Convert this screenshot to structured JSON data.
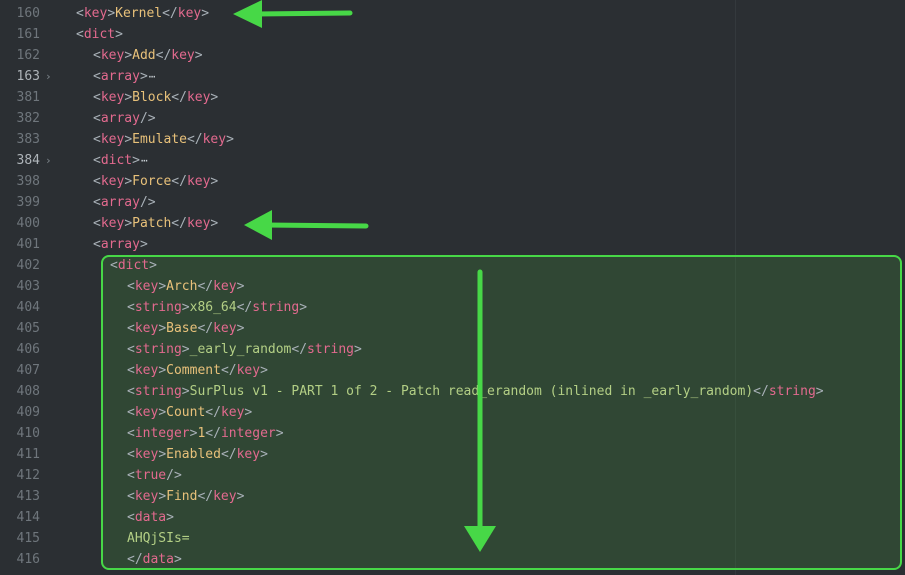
{
  "lines": [
    {
      "num": "160",
      "indent": 0,
      "fold": "",
      "parts": [
        [
          "p",
          "<"
        ],
        [
          "t",
          "key"
        ],
        [
          "p",
          ">"
        ],
        [
          "k",
          "Kernel"
        ],
        [
          "p",
          "</"
        ],
        [
          "t",
          "key"
        ],
        [
          "p",
          ">"
        ]
      ]
    },
    {
      "num": "161",
      "indent": 0,
      "fold": "",
      "parts": [
        [
          "p",
          "<"
        ],
        [
          "t",
          "dict"
        ],
        [
          "p",
          ">"
        ]
      ]
    },
    {
      "num": "162",
      "indent": 1,
      "fold": "",
      "parts": [
        [
          "p",
          "<"
        ],
        [
          "t",
          "key"
        ],
        [
          "p",
          ">"
        ],
        [
          "k",
          "Add"
        ],
        [
          "p",
          "</"
        ],
        [
          "t",
          "key"
        ],
        [
          "p",
          ">"
        ]
      ]
    },
    {
      "num": "163",
      "indent": 1,
      "fold": "›",
      "active": true,
      "collapsed": true,
      "parts": [
        [
          "p",
          "<"
        ],
        [
          "t",
          "array"
        ],
        [
          "p",
          ">"
        ]
      ]
    },
    {
      "num": "381",
      "indent": 1,
      "fold": "",
      "parts": [
        [
          "p",
          "<"
        ],
        [
          "t",
          "key"
        ],
        [
          "p",
          ">"
        ],
        [
          "k",
          "Block"
        ],
        [
          "p",
          "</"
        ],
        [
          "t",
          "key"
        ],
        [
          "p",
          ">"
        ]
      ]
    },
    {
      "num": "382",
      "indent": 1,
      "fold": "",
      "parts": [
        [
          "p",
          "<"
        ],
        [
          "t",
          "array"
        ],
        [
          "p",
          "/>"
        ]
      ]
    },
    {
      "num": "383",
      "indent": 1,
      "fold": "",
      "parts": [
        [
          "p",
          "<"
        ],
        [
          "t",
          "key"
        ],
        [
          "p",
          ">"
        ],
        [
          "k",
          "Emulate"
        ],
        [
          "p",
          "</"
        ],
        [
          "t",
          "key"
        ],
        [
          "p",
          ">"
        ]
      ]
    },
    {
      "num": "384",
      "indent": 1,
      "fold": "›",
      "active": true,
      "collapsed": true,
      "parts": [
        [
          "p",
          "<"
        ],
        [
          "t",
          "dict"
        ],
        [
          "p",
          ">"
        ]
      ]
    },
    {
      "num": "398",
      "indent": 1,
      "fold": "",
      "parts": [
        [
          "p",
          "<"
        ],
        [
          "t",
          "key"
        ],
        [
          "p",
          ">"
        ],
        [
          "k",
          "Force"
        ],
        [
          "p",
          "</"
        ],
        [
          "t",
          "key"
        ],
        [
          "p",
          ">"
        ]
      ]
    },
    {
      "num": "399",
      "indent": 1,
      "fold": "",
      "parts": [
        [
          "p",
          "<"
        ],
        [
          "t",
          "array"
        ],
        [
          "p",
          "/>"
        ]
      ]
    },
    {
      "num": "400",
      "indent": 1,
      "fold": "",
      "parts": [
        [
          "p",
          "<"
        ],
        [
          "t",
          "key"
        ],
        [
          "p",
          ">"
        ],
        [
          "k",
          "Patch"
        ],
        [
          "p",
          "</"
        ],
        [
          "t",
          "key"
        ],
        [
          "p",
          ">"
        ]
      ]
    },
    {
      "num": "401",
      "indent": 1,
      "fold": "",
      "parts": [
        [
          "p",
          "<"
        ],
        [
          "t",
          "array"
        ],
        [
          "p",
          ">"
        ]
      ]
    },
    {
      "num": "402",
      "indent": 2,
      "fold": "",
      "parts": [
        [
          "p",
          "<"
        ],
        [
          "t",
          "dict"
        ],
        [
          "p",
          ">"
        ]
      ]
    },
    {
      "num": "403",
      "indent": 3,
      "fold": "",
      "parts": [
        [
          "p",
          "<"
        ],
        [
          "t",
          "key"
        ],
        [
          "p",
          ">"
        ],
        [
          "k",
          "Arch"
        ],
        [
          "p",
          "</"
        ],
        [
          "t",
          "key"
        ],
        [
          "p",
          ">"
        ]
      ]
    },
    {
      "num": "404",
      "indent": 3,
      "fold": "",
      "parts": [
        [
          "p",
          "<"
        ],
        [
          "t",
          "string"
        ],
        [
          "p",
          ">"
        ],
        [
          "s",
          "x86_64"
        ],
        [
          "p",
          "</"
        ],
        [
          "t",
          "string"
        ],
        [
          "p",
          ">"
        ]
      ]
    },
    {
      "num": "405",
      "indent": 3,
      "fold": "",
      "parts": [
        [
          "p",
          "<"
        ],
        [
          "t",
          "key"
        ],
        [
          "p",
          ">"
        ],
        [
          "k",
          "Base"
        ],
        [
          "p",
          "</"
        ],
        [
          "t",
          "key"
        ],
        [
          "p",
          ">"
        ]
      ]
    },
    {
      "num": "406",
      "indent": 3,
      "fold": "",
      "parts": [
        [
          "p",
          "<"
        ],
        [
          "t",
          "string"
        ],
        [
          "p",
          ">"
        ],
        [
          "s",
          "_early_random"
        ],
        [
          "p",
          "</"
        ],
        [
          "t",
          "string"
        ],
        [
          "p",
          ">"
        ]
      ]
    },
    {
      "num": "407",
      "indent": 3,
      "fold": "",
      "parts": [
        [
          "p",
          "<"
        ],
        [
          "t",
          "key"
        ],
        [
          "p",
          ">"
        ],
        [
          "k",
          "Comment"
        ],
        [
          "p",
          "</"
        ],
        [
          "t",
          "key"
        ],
        [
          "p",
          ">"
        ]
      ]
    },
    {
      "num": "408",
      "indent": 3,
      "fold": "",
      "parts": [
        [
          "p",
          "<"
        ],
        [
          "t",
          "string"
        ],
        [
          "p",
          ">"
        ],
        [
          "s",
          "SurPlus v1 - PART 1 of 2 - Patch read_erandom (inlined in _early_random)"
        ],
        [
          "p",
          "</"
        ],
        [
          "t",
          "string"
        ],
        [
          "p",
          ">"
        ]
      ]
    },
    {
      "num": "409",
      "indent": 3,
      "fold": "",
      "parts": [
        [
          "p",
          "<"
        ],
        [
          "t",
          "key"
        ],
        [
          "p",
          ">"
        ],
        [
          "k",
          "Count"
        ],
        [
          "p",
          "</"
        ],
        [
          "t",
          "key"
        ],
        [
          "p",
          ">"
        ]
      ]
    },
    {
      "num": "410",
      "indent": 3,
      "fold": "",
      "parts": [
        [
          "p",
          "<"
        ],
        [
          "t",
          "integer"
        ],
        [
          "p",
          ">"
        ],
        [
          "n",
          "1"
        ],
        [
          "p",
          "</"
        ],
        [
          "t",
          "integer"
        ],
        [
          "p",
          ">"
        ]
      ]
    },
    {
      "num": "411",
      "indent": 3,
      "fold": "",
      "parts": [
        [
          "p",
          "<"
        ],
        [
          "t",
          "key"
        ],
        [
          "p",
          ">"
        ],
        [
          "k",
          "Enabled"
        ],
        [
          "p",
          "</"
        ],
        [
          "t",
          "key"
        ],
        [
          "p",
          ">"
        ]
      ]
    },
    {
      "num": "412",
      "indent": 3,
      "fold": "",
      "parts": [
        [
          "p",
          "<"
        ],
        [
          "t",
          "true"
        ],
        [
          "p",
          "/>"
        ]
      ]
    },
    {
      "num": "413",
      "indent": 3,
      "fold": "",
      "parts": [
        [
          "p",
          "<"
        ],
        [
          "t",
          "key"
        ],
        [
          "p",
          ">"
        ],
        [
          "k",
          "Find"
        ],
        [
          "p",
          "</"
        ],
        [
          "t",
          "key"
        ],
        [
          "p",
          ">"
        ]
      ]
    },
    {
      "num": "414",
      "indent": 3,
      "fold": "",
      "parts": [
        [
          "p",
          "<"
        ],
        [
          "t",
          "data"
        ],
        [
          "p",
          ">"
        ]
      ]
    },
    {
      "num": "415",
      "indent": 3,
      "fold": "",
      "parts": [
        [
          "d",
          "AHQjSIs="
        ]
      ]
    },
    {
      "num": "416",
      "indent": 3,
      "fold": "",
      "parts": [
        [
          "p",
          "</"
        ],
        [
          "t",
          "data"
        ],
        [
          "p",
          ">"
        ]
      ]
    }
  ],
  "collapsed_marker": "⋯",
  "colors": {
    "background": "#2b2f33",
    "tag": "#e36a8f",
    "key_text": "#e8c17a",
    "string_text": "#b3cf85",
    "highlight": "#47d847"
  },
  "annotations": {
    "arrows": [
      "arrow-to-kernel",
      "arrow-to-patch",
      "arrow-down-through-patch-dict"
    ]
  }
}
